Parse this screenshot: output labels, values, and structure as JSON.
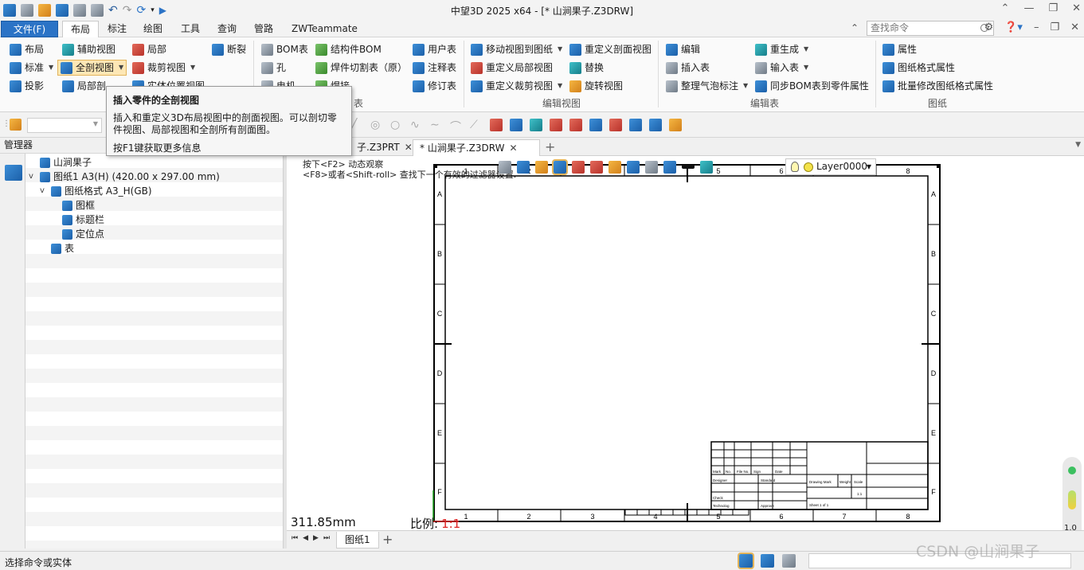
{
  "app": {
    "title": "中望3D 2025 x64 - [* 山涧果子.Z3DRW]"
  },
  "menu": {
    "tabs": [
      "文件(F)",
      "布局",
      "标注",
      "绘图",
      "工具",
      "查询",
      "管路",
      "ZWTeammate"
    ],
    "active": "布局",
    "search_placeholder": "查找命令"
  },
  "ribbon": {
    "views": {
      "col1": [
        "布局",
        "标准",
        "投影"
      ],
      "col2": [
        "辅助视图",
        "全剖视图",
        "局部剖"
      ],
      "col3": [
        "局部",
        "裁剪视图",
        "实体位置视图"
      ],
      "col4": [
        "断裂"
      ]
    },
    "tables": {
      "col1": [
        "BOM表",
        "孔",
        "电机"
      ],
      "col2": [
        "结构件BOM",
        "焊件切割表（原）",
        "焊接"
      ],
      "col3": [
        "用户表",
        "注释表",
        "修订表"
      ],
      "group_label": "表"
    },
    "edit_view": {
      "col1": [
        "移动视图到图纸",
        "重定义局部视图",
        "重定义裁剪视图"
      ],
      "col2": [
        "重定义剖面视图",
        "替换",
        "旋转视图"
      ],
      "group_label": "编辑视图"
    },
    "edit_table": {
      "col1": [
        "编辑",
        "插入表",
        "整理气泡标注"
      ],
      "col2": [
        "重生成",
        "输入表",
        "同步BOM表到零件属性"
      ],
      "group_label": "编辑表"
    },
    "drawing": {
      "col1": [
        "属性",
        "图纸格式属性",
        "批量修改图纸格式属性"
      ],
      "group_label": "图纸"
    }
  },
  "tooltip": {
    "title": "插入零件的全剖视图",
    "body": "插入和重定义3D布局视图中的剖面视图。可以剖切零件视图、局部视图和全剖所有剖面图。",
    "help": "按F1键获取更多信息"
  },
  "manager": {
    "title": "管理器",
    "tree": [
      {
        "label": "山涧果子",
        "level": 0,
        "expand": ""
      },
      {
        "label": "图纸1 A3(H) (420.00 x 297.00 mm)",
        "level": 0,
        "expand": "v"
      },
      {
        "label": "图纸格式 A3_H(GB)",
        "level": 1,
        "expand": "v"
      },
      {
        "label": "图框",
        "level": 2,
        "expand": ""
      },
      {
        "label": "标题栏",
        "level": 2,
        "expand": ""
      },
      {
        "label": "定位点",
        "level": 2,
        "expand": ""
      },
      {
        "label": "表",
        "level": 1,
        "expand": ""
      }
    ]
  },
  "doc_tabs": [
    {
      "label": "子.Z3PRT",
      "active": false
    },
    {
      "label": "* 山涧果子.Z3DRW",
      "active": true
    }
  ],
  "canvas": {
    "hint_line1": "按下<F2> 动态观察",
    "hint_line2": "<F8>或者<Shift-roll> 查找下一个有效的过滤器设置.",
    "layer": "Layer0000",
    "length": "311.85mm",
    "scale_label": "比例:",
    "scale_value": "1:1",
    "frame_cols": [
      "1",
      "2",
      "3",
      "4",
      "5",
      "6",
      "7",
      "8"
    ],
    "frame_rows": [
      "A",
      "B",
      "C",
      "D",
      "E",
      "F"
    ],
    "gauge_value": "1.0"
  },
  "sheets": {
    "tabs": [
      "图纸1"
    ]
  },
  "status": {
    "text": "选择命令或实体"
  },
  "watermark": "CSDN @山涧果子"
}
